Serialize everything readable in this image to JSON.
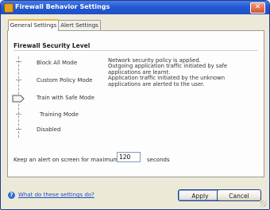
{
  "window": {
    "title": "Firewall Behavior Settings",
    "close_glyph": "✕"
  },
  "tabs": [
    {
      "label": "General Settings",
      "active": true
    },
    {
      "label": "Alert Settings",
      "active": false
    }
  ],
  "security": {
    "title": "Firewall Security Level",
    "levels": [
      {
        "label": "Block All Mode"
      },
      {
        "label": "Custom Policy Mode"
      },
      {
        "label": "Train with Safe Mode",
        "selected": true
      },
      {
        "label": "Training Mode"
      },
      {
        "label": "Disabled"
      }
    ],
    "description": [
      "Network security policy is applied.",
      "Outgoing application traffic initiated by safe applications are learnt.",
      "Application traffic initiated by the unknown applications are alerted to the user."
    ]
  },
  "alert": {
    "label": "Keep an alert on screen for maximum",
    "value": "120",
    "unit": "seconds"
  },
  "footer": {
    "help_link": "What do these settings do?",
    "apply": "Apply",
    "cancel": "Cancel"
  },
  "colors": {
    "titlebar": "#2459d4",
    "accent_tab": "#f1b53e",
    "link": "#1f4dc4"
  }
}
